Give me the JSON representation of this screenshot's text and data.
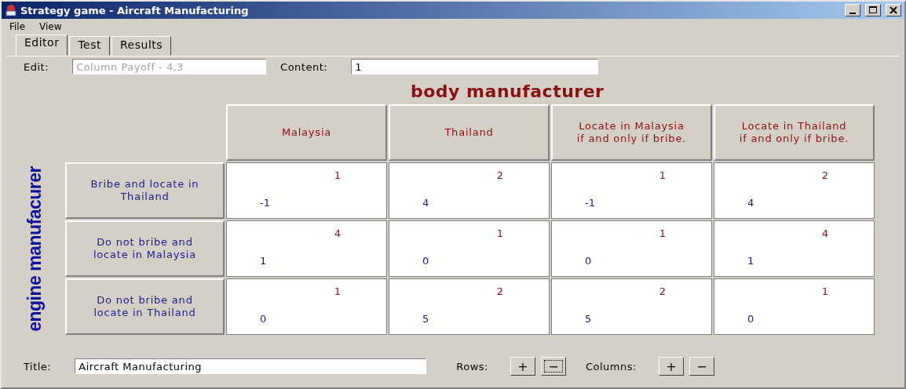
{
  "window": {
    "title": "Strategy game - Aircraft Manufacturing"
  },
  "menu": [
    "File",
    "View"
  ],
  "tabs": [
    {
      "label": "Editor",
      "selected": true
    },
    {
      "label": "Test",
      "selected": false
    },
    {
      "label": "Results",
      "selected": false
    }
  ],
  "edit": {
    "label": "Edit:",
    "value": "Column Payoff - 4,3",
    "disabled": true
  },
  "content": {
    "label": "Content:",
    "value": "1"
  },
  "matrix": {
    "column_player": "body manufacturer",
    "row_player": "engine manufacurer",
    "columns": [
      "Malaysia",
      "Thailand",
      "Locate in Malaysia if and only if bribe.",
      "Locate in Thailand if and only if bribe."
    ],
    "rows": [
      {
        "label": "Bribe and locate in Thailand",
        "cells": [
          {
            "column_payoff": "1",
            "row_payoff": "-1"
          },
          {
            "column_payoff": "2",
            "row_payoff": "4"
          },
          {
            "column_payoff": "1",
            "row_payoff": "-1"
          },
          {
            "column_payoff": "2",
            "row_payoff": "4"
          }
        ]
      },
      {
        "label": "Do not bribe and locate in Malaysia",
        "cells": [
          {
            "column_payoff": "4",
            "row_payoff": "1"
          },
          {
            "column_payoff": "1",
            "row_payoff": "0"
          },
          {
            "column_payoff": "1",
            "row_payoff": "0"
          },
          {
            "column_payoff": "4",
            "row_payoff": "1"
          }
        ]
      },
      {
        "label": "Do not bribe and locate in Thailand",
        "cells": [
          {
            "column_payoff": "1",
            "row_payoff": "0"
          },
          {
            "column_payoff": "2",
            "row_payoff": "5"
          },
          {
            "column_payoff": "2",
            "row_payoff": "5"
          },
          {
            "column_payoff": "1",
            "row_payoff": "0"
          }
        ]
      }
    ]
  },
  "footer": {
    "title_label": "Title:",
    "title_value": "Aircraft Manufacturing",
    "rows_label": "Rows:",
    "rows_buttons": [
      {
        "label": "+",
        "focused": false
      },
      {
        "label": "−",
        "focused": true
      }
    ],
    "columns_label": "Columns:",
    "columns_buttons": [
      {
        "label": "+",
        "focused": false
      },
      {
        "label": "−",
        "focused": false
      }
    ]
  }
}
